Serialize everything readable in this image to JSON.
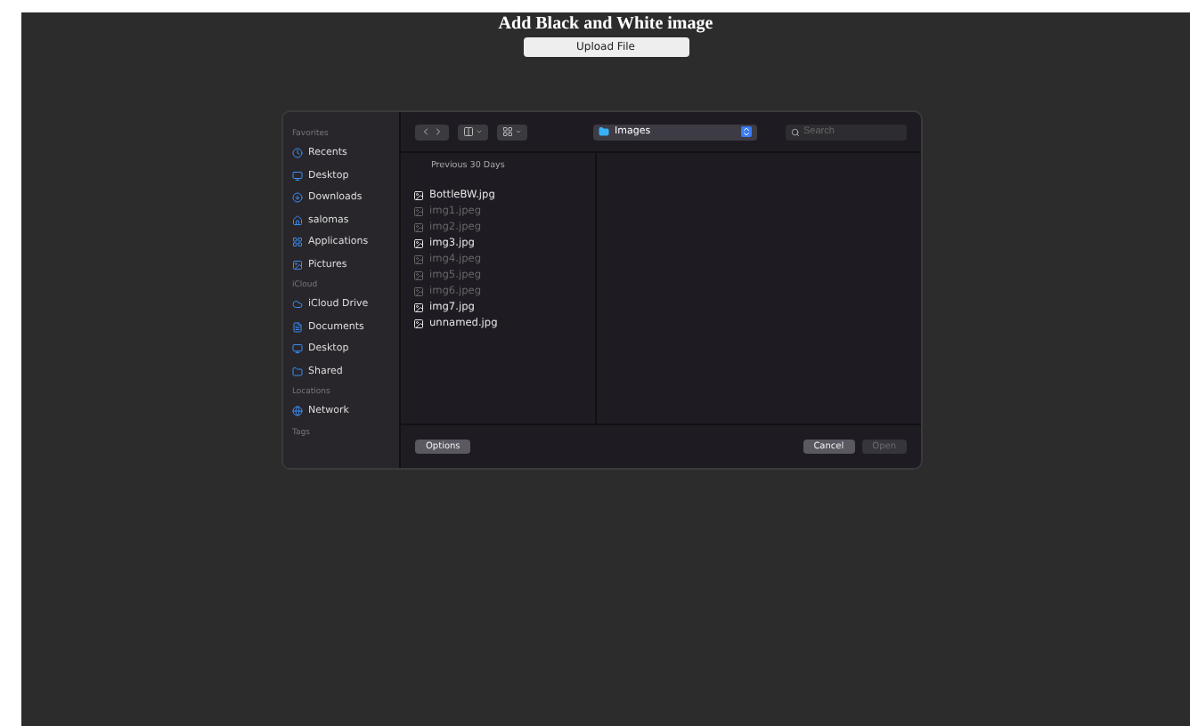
{
  "page": {
    "title": "Add Black and White image",
    "upload_button": "Upload File"
  },
  "dialog": {
    "toolbar": {
      "location": "Images",
      "search": {
        "placeholder": "Search"
      }
    },
    "sidebar": [
      {
        "heading": "Favorites",
        "items": [
          {
            "label": "Recents",
            "kind": "clock"
          },
          {
            "label": "Desktop",
            "kind": "monitor"
          },
          {
            "label": "Downloads",
            "kind": "download"
          },
          {
            "label": "salomas",
            "kind": "home"
          },
          {
            "label": "Applications",
            "kind": "apps"
          },
          {
            "label": "Pictures",
            "kind": "image"
          }
        ]
      },
      {
        "heading": "iCloud",
        "items": [
          {
            "label": "iCloud Drive",
            "kind": "cloud"
          },
          {
            "label": "Documents",
            "kind": "doc"
          },
          {
            "label": "Desktop",
            "kind": "monitor"
          },
          {
            "label": "Shared",
            "kind": "folder"
          }
        ]
      },
      {
        "heading": "Locations",
        "items": [
          {
            "label": "Network",
            "kind": "globe"
          }
        ]
      },
      {
        "heading": "Tags"
      }
    ],
    "group_header": "Previous 30 Days",
    "files": [
      {
        "name": "BottleBW.jpg",
        "disabled": false
      },
      {
        "name": "img1.jpeg",
        "disabled": true
      },
      {
        "name": "img2.jpeg",
        "disabled": true
      },
      {
        "name": "img3.jpg",
        "disabled": false
      },
      {
        "name": "img4.jpeg",
        "disabled": true
      },
      {
        "name": "img5.jpeg",
        "disabled": true
      },
      {
        "name": "img6.jpeg",
        "disabled": true
      },
      {
        "name": "img7.jpg",
        "disabled": false
      },
      {
        "name": "unnamed.jpg",
        "disabled": false
      }
    ],
    "buttons": {
      "options": "Options",
      "cancel": "Cancel",
      "open": {
        "label": "Open",
        "disabled": true
      }
    }
  }
}
